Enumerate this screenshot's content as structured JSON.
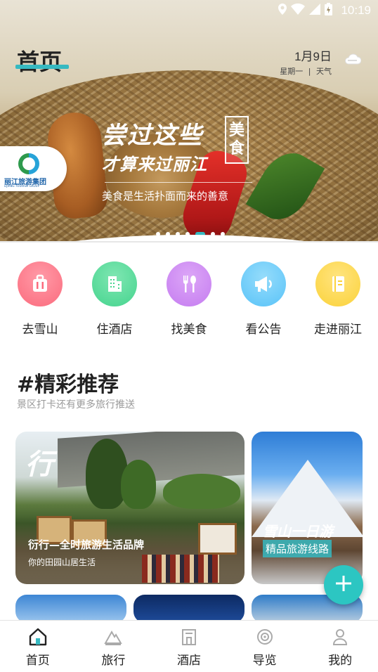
{
  "status_bar": {
    "time": "10:19",
    "icons": [
      "location-icon",
      "wifi-icon",
      "signal-icon",
      "battery-icon"
    ]
  },
  "header": {
    "title": "首页",
    "date": "1月9日",
    "weekday": "星期一",
    "separator": "|",
    "weather": "天气",
    "weather_icon": "cloud-icon",
    "accent_color": "#36b9c1"
  },
  "banner": {
    "line1": "尝过这些",
    "line2": "才算来过丽江",
    "badge": [
      "美",
      "食"
    ],
    "subtitle": "美食是生活扑面而来的善意",
    "logo_name": "丽江旅游集团",
    "logo_en": "LIJIANG TOURISM GROUP",
    "page_count": 7,
    "active_page": 5
  },
  "shortcuts": [
    {
      "label": "去雪山",
      "icon": "luggage-icon",
      "color": "#fb6b7d"
    },
    {
      "label": "住酒店",
      "icon": "building-icon",
      "color": "#45d48e"
    },
    {
      "label": "找美食",
      "icon": "fork-spoon-icon",
      "color": "#c57cf0"
    },
    {
      "label": "看公告",
      "icon": "megaphone-icon",
      "color": "#59c3f8"
    },
    {
      "label": "走进丽江",
      "icon": "book-icon",
      "color": "#fbd23a"
    }
  ],
  "recommend": {
    "title": "#精彩推荐",
    "subtitle": "景区打卡还有更多旅行推送",
    "cards": [
      {
        "brush": "行",
        "title": "衍行—全时旅游生活品牌",
        "subtitle": "你的田园山居生活"
      },
      {
        "title": "雪山一日游",
        "tag": "精品旅游线路"
      }
    ]
  },
  "fab": {
    "icon": "plus-icon"
  },
  "bottom_nav": [
    {
      "label": "首页",
      "icon": "home-icon",
      "active": true
    },
    {
      "label": "旅行",
      "icon": "mountain-icon",
      "active": false
    },
    {
      "label": "酒店",
      "icon": "hotel-icon",
      "active": false
    },
    {
      "label": "导览",
      "icon": "compass-icon",
      "active": false
    },
    {
      "label": "我的",
      "icon": "person-icon",
      "active": false
    }
  ]
}
